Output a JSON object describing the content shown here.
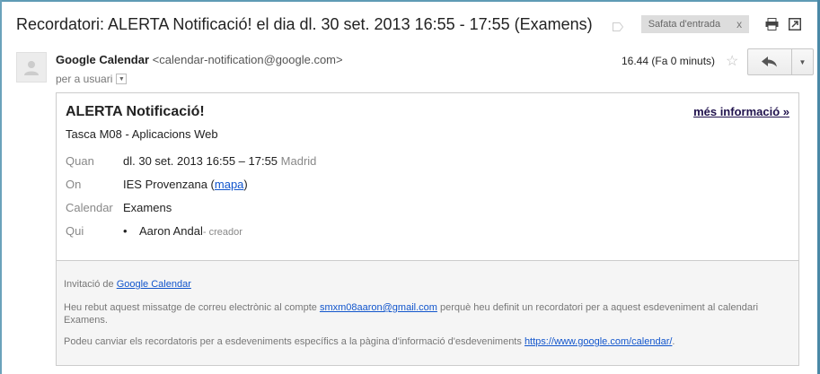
{
  "header": {
    "subject": "Recordatori: ALERTA Notificació! el dia dl. 30 set. 2013 16:55 - 17:55 (Examens)",
    "label": "Safata d'entrada",
    "label_remove": "x"
  },
  "message": {
    "sender_name": "Google Calendar",
    "sender_email": "<calendar-notification@google.com>",
    "to_text": "per a usuari",
    "time": "16.44 (Fa 0 minuts)"
  },
  "card": {
    "title": "ALERTA Notificació!",
    "more_info": "més informació »",
    "subtitle": "Tasca M08 - Aplicacions Web",
    "when_label": "Quan",
    "when_value": "dl. 30 set. 2013 16:55 – 17:55",
    "when_tz": "Madrid",
    "where_label": "On",
    "where_value": "IES Provenzana (",
    "where_link": "mapa",
    "where_close": ")",
    "calendar_label": "Calendar",
    "calendar_value": "Examens",
    "who_label": "Qui",
    "who_bullet": "•",
    "who_name": "Aaron Andal",
    "who_role": "- creador"
  },
  "footer": {
    "invite_prefix": "Invitació de ",
    "invite_link": "Google Calendar",
    "reason_prefix": "Heu rebut aquest missatge de correu electrònic al compte ",
    "reason_email": "smxm08aaron@gmail.com",
    "reason_suffix": " perquè heu definit un recordatori per a aquest esdeveniment al calendari Examens.",
    "change_prefix": "Podeu canviar els recordatoris per a esdeveniments específics a la pàgina d'informació d'esdeveniments ",
    "change_link": "https://www.google.com/calendar/",
    "change_suffix": "."
  }
}
